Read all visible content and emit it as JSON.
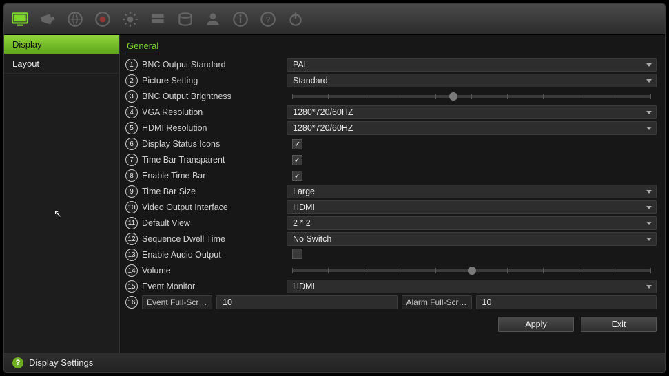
{
  "toolbar": {
    "icons": [
      "monitor-icon",
      "camera-icon",
      "network-icon",
      "record-icon",
      "alarm-icon",
      "storage-icon",
      "hdd-icon",
      "user-icon",
      "info-icon",
      "help-icon",
      "power-icon"
    ]
  },
  "sidebar": {
    "items": [
      {
        "label": "Display",
        "active": true
      },
      {
        "label": "Layout",
        "active": false
      }
    ]
  },
  "tab": {
    "label": "General"
  },
  "rows": [
    {
      "n": "1",
      "label": "BNC Output Standard",
      "type": "select",
      "value": "PAL"
    },
    {
      "n": "2",
      "label": "Picture Setting",
      "type": "select",
      "value": "Standard"
    },
    {
      "n": "3",
      "label": "BNC Output Brightness",
      "type": "slider",
      "pos": 45
    },
    {
      "n": "4",
      "label": "VGA Resolution",
      "type": "select",
      "value": "1280*720/60HZ"
    },
    {
      "n": "5",
      "label": "HDMI Resolution",
      "type": "select",
      "value": "1280*720/60HZ"
    },
    {
      "n": "6",
      "label": "Display Status Icons",
      "type": "check",
      "checked": true
    },
    {
      "n": "7",
      "label": "Time Bar Transparent",
      "type": "check",
      "checked": true
    },
    {
      "n": "8",
      "label": "Enable Time Bar",
      "type": "check",
      "checked": true
    },
    {
      "n": "9",
      "label": "Time Bar Size",
      "type": "select",
      "value": "Large"
    },
    {
      "n": "10",
      "label": "Video Output Interface",
      "type": "select",
      "value": "HDMI"
    },
    {
      "n": "11",
      "label": "Default View",
      "type": "select",
      "value": "2 * 2"
    },
    {
      "n": "12",
      "label": "Sequence Dwell Time",
      "type": "select",
      "value": "No Switch"
    },
    {
      "n": "13",
      "label": "Enable Audio Output",
      "type": "check",
      "checked": false
    },
    {
      "n": "14",
      "label": "Volume",
      "type": "slider",
      "pos": 50
    },
    {
      "n": "15",
      "label": "Event Monitor",
      "type": "select",
      "value": "HDMI"
    },
    {
      "n": "16",
      "label": "",
      "type": "dual",
      "left_label": "Event Full-Scr…",
      "left_value": "10",
      "right_label": "Alarm Full-Scr…",
      "right_value": "10"
    }
  ],
  "buttons": {
    "apply": "Apply",
    "exit": "Exit"
  },
  "footer": {
    "title": "Display Settings"
  }
}
